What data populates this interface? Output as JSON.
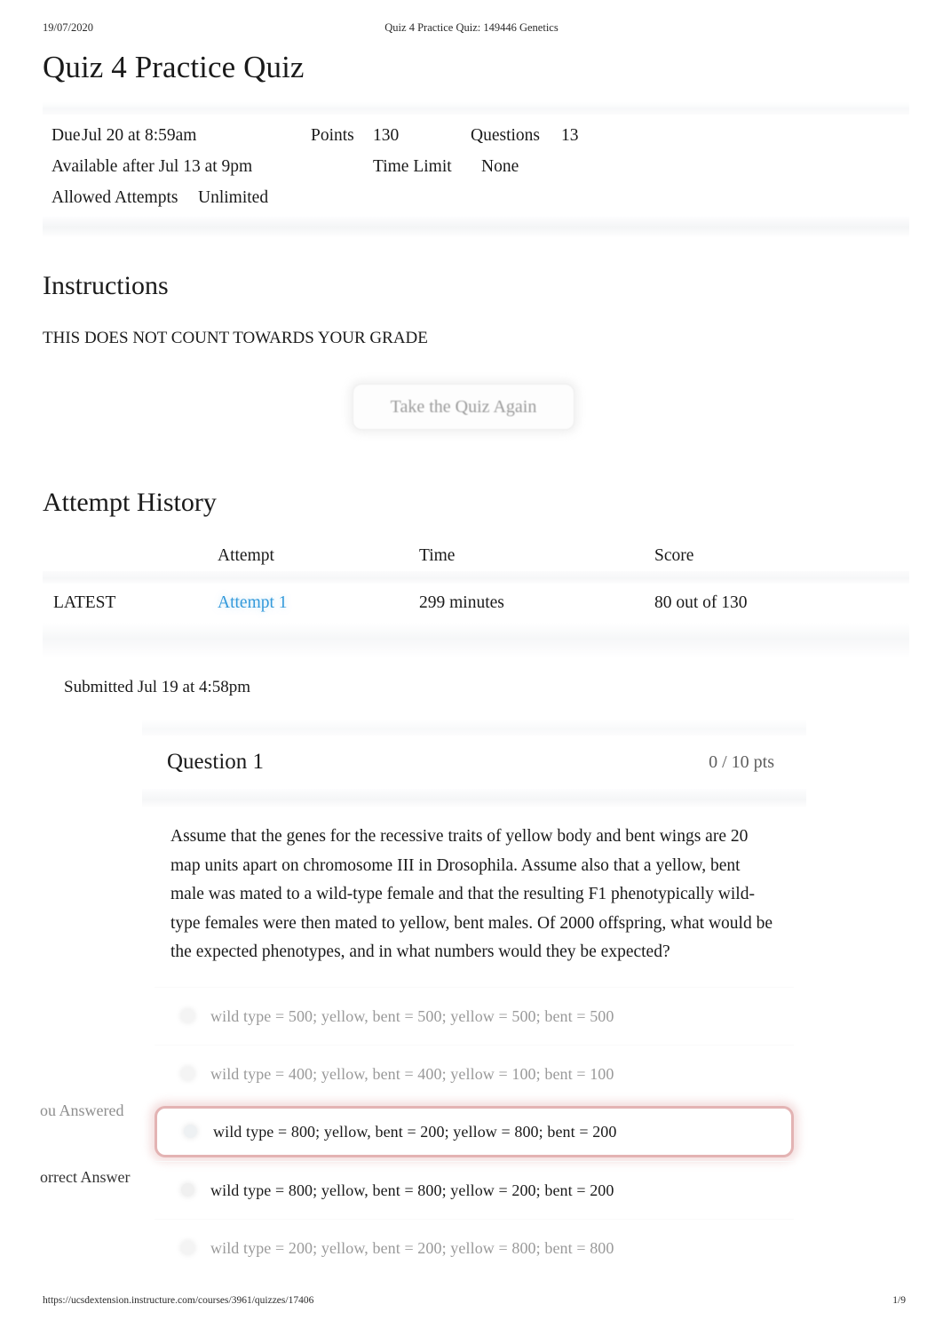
{
  "print_header": {
    "date": "19/07/2020",
    "title": "Quiz 4 Practice Quiz: 149446 Genetics"
  },
  "print_footer": {
    "url": "https://ucsdextension.instructure.com/courses/3961/quizzes/17406",
    "page": "1/9"
  },
  "quiz": {
    "title": "Quiz 4 Practice Quiz",
    "meta": {
      "due_label": "Due",
      "due_value": "Jul 20 at 8:59am",
      "points_label": "Points",
      "points_value": "130",
      "questions_label": "Questions",
      "questions_value": "13",
      "available_label": "Available",
      "available_value": "after Jul 13 at 9pm",
      "time_limit_label": "Time Limit",
      "time_limit_value": "None",
      "attempts_label": "Allowed Attempts",
      "attempts_value": "Unlimited"
    }
  },
  "instructions": {
    "heading": "Instructions",
    "body": "THIS DOES NOT COUNT TOWARDS YOUR GRADE",
    "retake_button": "Take the Quiz Again"
  },
  "attempt_history": {
    "heading": "Attempt History",
    "columns": {
      "blank": "",
      "attempt": "Attempt",
      "time": "Time",
      "score": "Score"
    },
    "rows": [
      {
        "marker": "LATEST",
        "attempt": "Attempt 1",
        "time": "299 minutes",
        "score": "80 out of 130"
      }
    ],
    "submitted": "Submitted Jul 19 at 4:58pm"
  },
  "question": {
    "number_label": "Question 1",
    "points": "0 / 10 pts",
    "text": "Assume that the genes for the recessive traits of yellow body and bent wings are 20 map units apart on chromosome III in Drosophila. Assume also that a yellow, bent male was mated to a wild-type female and that the resulting F1 phenotypically wild-type females were then mated to yellow, bent males. Of 2000 offspring, what would be the expected phenotypes, and in what numbers would they be expected?",
    "you_answered_label": "ou Answered",
    "correct_answer_label": "orrect Answer",
    "options": [
      {
        "text": "wild type = 500; yellow, bent = 500; yellow = 500; bent = 500",
        "state": "faded"
      },
      {
        "text": "wild type = 400; yellow, bent = 400; yellow = 100; bent = 100",
        "state": "faded"
      },
      {
        "text": "wild type = 800; yellow, bent = 200; yellow = 800; bent = 200",
        "state": "selected"
      },
      {
        "text": "wild type = 800; yellow, bent = 800; yellow = 200; bent = 200",
        "state": "dark"
      },
      {
        "text": "wild type = 200; yellow, bent = 200; yellow = 800; bent = 800",
        "state": "faded"
      }
    ]
  },
  "colors": {
    "link": "#3399db",
    "selected_border": "#e3b3b3",
    "muted_text": "#9a9a9a"
  }
}
